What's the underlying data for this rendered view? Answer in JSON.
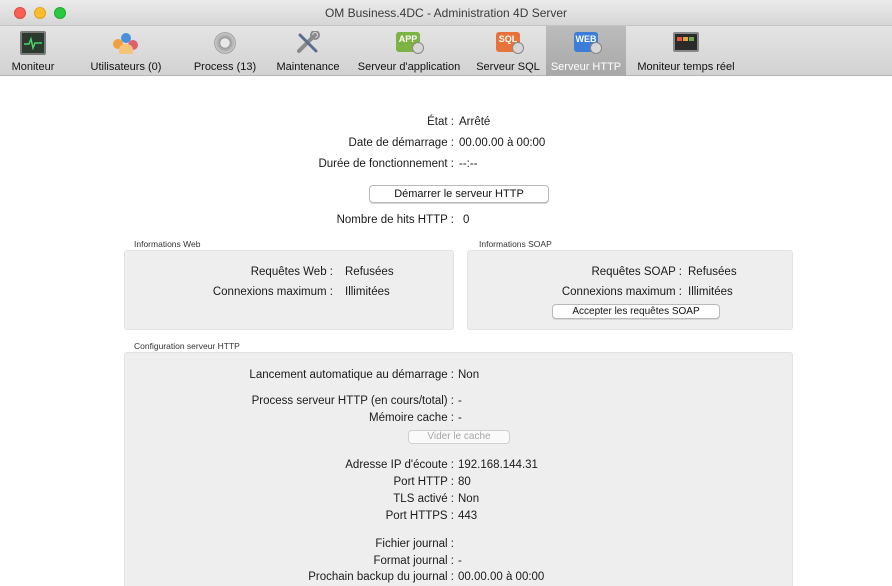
{
  "window": {
    "title": "OM Business.4DC - Administration 4D Server"
  },
  "toolbar": {
    "items": [
      {
        "label": "Moniteur",
        "icon": "monitor-icon"
      },
      {
        "label": "Utilisateurs (0)",
        "icon": "users-icon"
      },
      {
        "label": "Process (13)",
        "icon": "gear-icon"
      },
      {
        "label": "Maintenance",
        "icon": "tools-icon"
      },
      {
        "label": "Serveur d'application",
        "icon": "app-server-icon",
        "badge": "APP"
      },
      {
        "label": "Serveur SQL",
        "icon": "sql-server-icon",
        "badge": "SQL"
      },
      {
        "label": "Serveur HTTP",
        "icon": "http-server-icon",
        "badge": "WEB"
      },
      {
        "label": "Moniteur temps réel",
        "icon": "realtime-monitor-icon"
      }
    ],
    "active_index": 6
  },
  "status": {
    "state_label": "État :",
    "state_value": "Arrêté",
    "start_label": "Date de démarrage :",
    "start_value": "00.00.00 à 00:00",
    "uptime_label": "Durée de fonctionnement :",
    "uptime_value": "--:--",
    "start_button": "Démarrer le serveur HTTP",
    "hits_label": "Nombre de hits HTTP :",
    "hits_value": "0"
  },
  "web_info": {
    "title": "Informations Web",
    "requests_label": "Requêtes Web :",
    "requests_value": "Refusées",
    "max_conn_label": "Connexions maximum :",
    "max_conn_value": "Illimitées"
  },
  "soap_info": {
    "title": "Informations SOAP",
    "requests_label": "Requêtes SOAP :",
    "requests_value": "Refusées",
    "max_conn_label": "Connexions maximum :",
    "max_conn_value": "Illimitées",
    "accept_button": "Accepter les requêtes SOAP"
  },
  "config": {
    "title": "Configuration serveur HTTP",
    "autostart_label": "Lancement automatique au démarrage :",
    "autostart_value": "Non",
    "process_label": "Process serveur HTTP (en cours/total) :",
    "process_value": "-",
    "cache_label": "Mémoire cache :",
    "cache_value": "-",
    "clear_cache_button": "Vider le cache",
    "ip_label": "Adresse IP d'écoute :",
    "ip_value": "192.168.144.31",
    "http_port_label": "Port HTTP :",
    "http_port_value": "80",
    "tls_label": "TLS activé :",
    "tls_value": "Non",
    "https_port_label": "Port HTTPS :",
    "https_port_value": "443",
    "log_file_label": "Fichier journal :",
    "log_file_value": "",
    "log_format_label": "Format journal :",
    "log_format_value": "-",
    "next_backup_label": "Prochain backup du journal :",
    "next_backup_value": "00.00.00 à 00:00"
  }
}
